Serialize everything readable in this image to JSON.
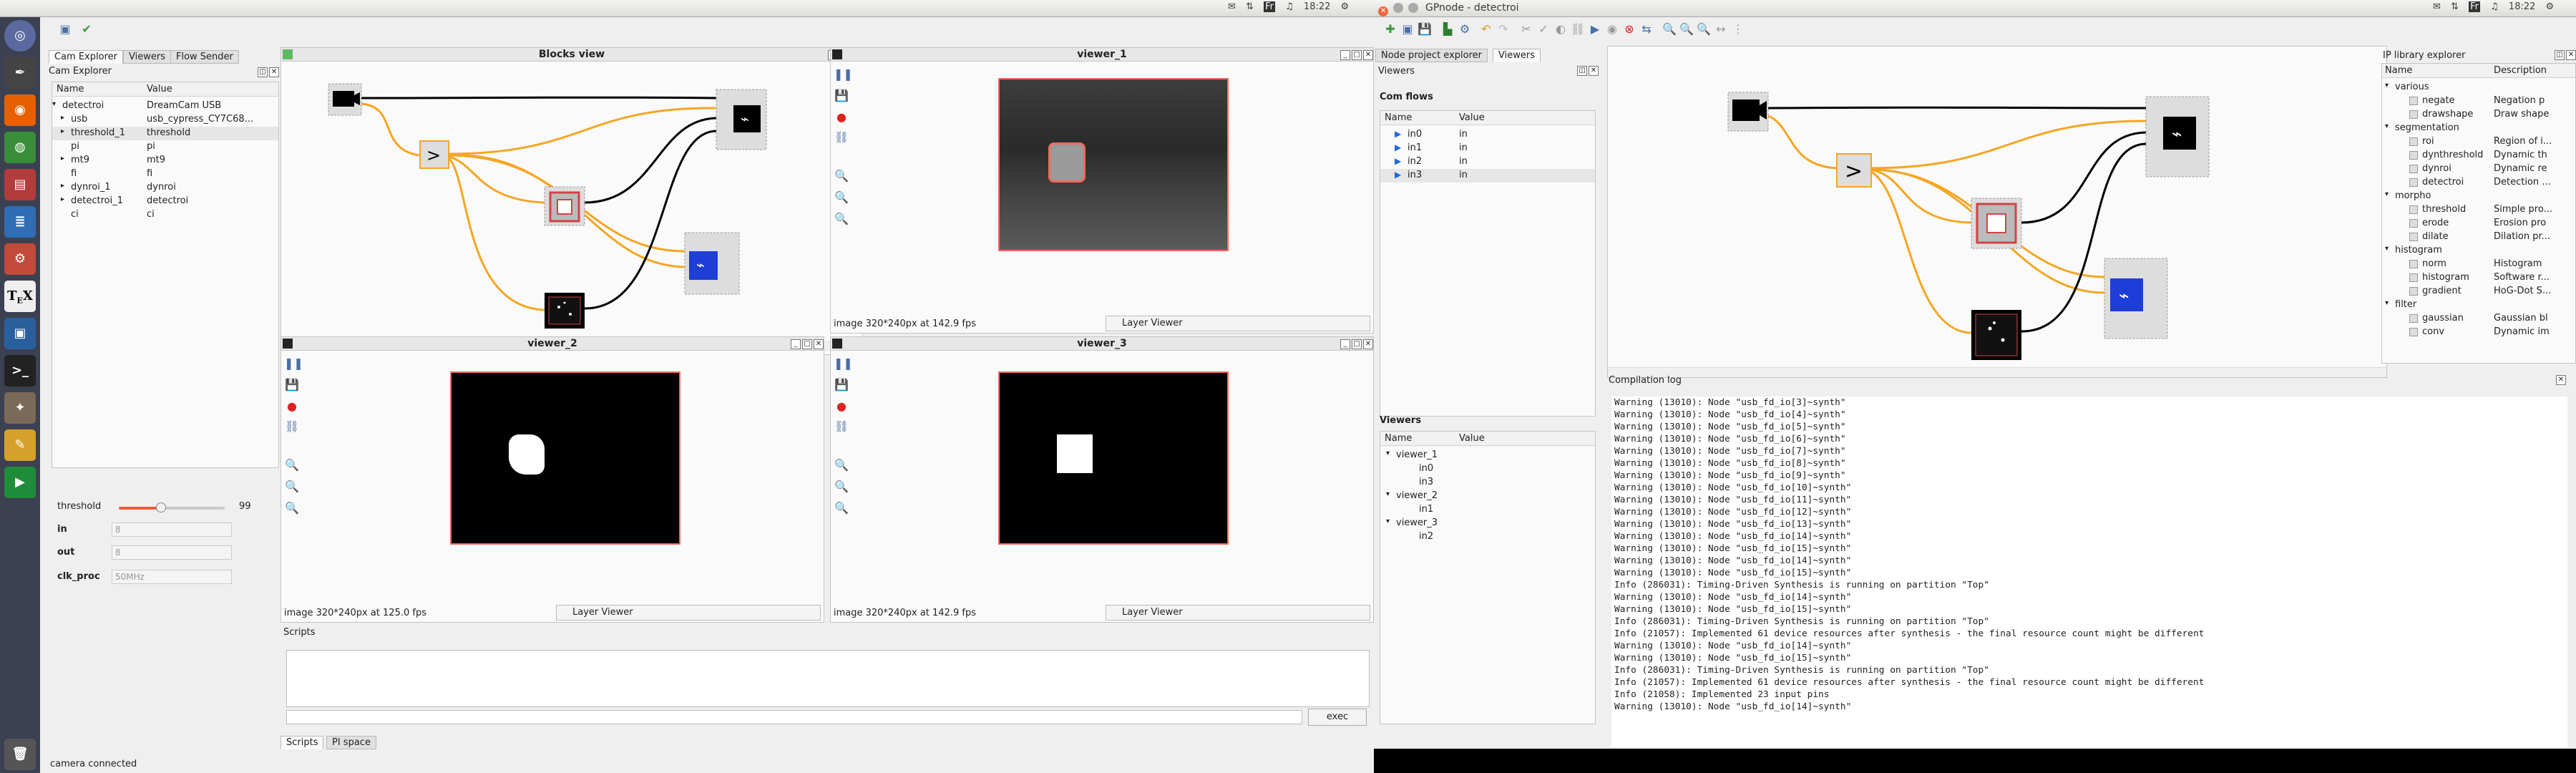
{
  "topbar": {
    "title": "GPnode - detectroi",
    "time": "18:22",
    "keyboard": "Fr",
    "tray_left": [
      "✉",
      "⇅",
      "Fr",
      "♫",
      "18:22",
      "⚙"
    ],
    "tray_right": [
      "✉",
      "⇅",
      "Fr",
      "♫",
      "18:22",
      "⚙"
    ]
  },
  "launcher": {
    "items": [
      "dash",
      "inkscape",
      "firefox",
      "chrome",
      "presentation",
      "writer",
      "settings",
      "tex",
      "display",
      "terminal",
      "gimp",
      "tools",
      "media",
      "trash"
    ]
  },
  "cam": {
    "tabs": [
      "Cam Explorer",
      "Viewers",
      "Flow Sender"
    ],
    "title": "Cam Explorer",
    "col_name": "Name",
    "col_value": "Value",
    "tree": [
      {
        "name": "detectroi",
        "value": "DreamCam USB"
      },
      {
        "name": "usb",
        "value": "usb_cypress_CY7C68..."
      },
      {
        "name": "threshold_1",
        "value": "threshold"
      },
      {
        "name": "pi",
        "value": "pi"
      },
      {
        "name": "mt9",
        "value": "mt9"
      },
      {
        "name": "fi",
        "value": "fi"
      },
      {
        "name": "dynroi_1",
        "value": "dynroi"
      },
      {
        "name": "detectroi_1",
        "value": "detectroi"
      },
      {
        "name": "ci",
        "value": "ci"
      }
    ],
    "props": {
      "threshold_label": "threshold",
      "threshold_value": 99,
      "threshold_frac": 0.4,
      "in_label": "in",
      "in_value": "8",
      "out_label": "out",
      "out_value": "8",
      "clk_label": "clk_proc",
      "clk_value": "50MHz"
    },
    "status": "camera connected"
  },
  "blocks": {
    "title": "Blocks view"
  },
  "viewers": [
    {
      "title": "viewer_1",
      "status": "image 320*240px at 142.9 fps",
      "layer": "Layer Viewer"
    },
    {
      "title": "viewer_2",
      "status": "image 320*240px at 125.0 fps",
      "layer": "Layer Viewer"
    },
    {
      "title": "viewer_3",
      "status": "image 320*240px at 142.9 fps",
      "layer": "Layer Viewer"
    }
  ],
  "scripts": {
    "title": "Scripts",
    "exec": "exec",
    "tabs": [
      "Scripts",
      "PI space"
    ]
  },
  "gp": {
    "tabs": [
      "Node project explorer",
      "Viewers"
    ],
    "viewers_title": "Viewers",
    "comflows": {
      "title": "Com flows",
      "col_name": "Name",
      "col_value": "Value",
      "rows": [
        {
          "name": "in0",
          "value": "in"
        },
        {
          "name": "in1",
          "value": "in"
        },
        {
          "name": "in2",
          "value": "in"
        },
        {
          "name": "in3",
          "value": "in"
        }
      ]
    },
    "viewers_tree": {
      "title": "Viewers",
      "col_name": "Name",
      "col_value": "Value",
      "items": [
        {
          "name": "viewer_1",
          "children": [
            "in0",
            "in3"
          ]
        },
        {
          "name": "viewer_2",
          "children": [
            "in1"
          ]
        },
        {
          "name": "viewer_3",
          "children": [
            "in2"
          ]
        }
      ]
    },
    "compilation": {
      "title": "Compilation log",
      "lines": [
        "Warning (13010): Node \"usb_fd_io[3]~synth\"",
        "Warning (13010): Node \"usb_fd_io[4]~synth\"",
        "Warning (13010): Node \"usb_fd_io[5]~synth\"",
        "Warning (13010): Node \"usb_fd_io[6]~synth\"",
        "Warning (13010): Node \"usb_fd_io[7]~synth\"",
        "Warning (13010): Node \"usb_fd_io[8]~synth\"",
        "Warning (13010): Node \"usb_fd_io[9]~synth\"",
        "Warning (13010): Node \"usb_fd_io[10]~synth\"",
        "Warning (13010): Node \"usb_fd_io[11]~synth\"",
        "Warning (13010): Node \"usb_fd_io[12]~synth\"",
        "Warning (13010): Node \"usb_fd_io[13]~synth\"",
        "Warning (13010): Node \"usb_fd_io[14]~synth\"",
        "Warning (13010): Node \"usb_fd_io[15]~synth\"",
        "Warning (13010): Node \"usb_fd_io[14]~synth\"",
        "Warning (13010): Node \"usb_fd_io[15]~synth\"",
        "Info (286031): Timing-Driven Synthesis is running on partition \"Top\"",
        "Warning (13010): Node \"usb_fd_io[14]~synth\"",
        "Warning (13010): Node \"usb_fd_io[15]~synth\"",
        "Info (286031): Timing-Driven Synthesis is running on partition \"Top\"",
        "Info (21057): Implemented 61 device resources after synthesis - the final resource count might be different",
        "Warning (13010): Node \"usb_fd_io[14]~synth\"",
        "Warning (13010): Node \"usb_fd_io[15]~synth\"",
        "Info (286031): Timing-Driven Synthesis is running on partition \"Top\"",
        "Info (21057): Implemented 61 device resources after synthesis - the final resource count might be different",
        "Info (21058): Implemented 23 input pins",
        "Warning (13010): Node \"usb_fd_io[14]~synth\""
      ]
    },
    "iplib": {
      "title": "IP library explorer",
      "col_name": "Name",
      "col_desc": "Description",
      "groups": [
        {
          "name": "various",
          "items": [
            {
              "name": "negate",
              "desc": "Negation p"
            },
            {
              "name": "drawshape",
              "desc": "Draw shape"
            }
          ]
        },
        {
          "name": "segmentation",
          "items": [
            {
              "name": "roi",
              "desc": "Region of i..."
            },
            {
              "name": "dynthreshold",
              "desc": "Dynamic th"
            },
            {
              "name": "dynroi",
              "desc": "Dynamic re"
            },
            {
              "name": "detectroi",
              "desc": "Detection ..."
            }
          ]
        },
        {
          "name": "morpho",
          "items": [
            {
              "name": "threshold",
              "desc": "Simple pro..."
            },
            {
              "name": "erode",
              "desc": "Erosion pro"
            },
            {
              "name": "dilate",
              "desc": "Dilation pr..."
            }
          ]
        },
        {
          "name": "histogram",
          "items": [
            {
              "name": "norm",
              "desc": "Histogram"
            },
            {
              "name": "histogram",
              "desc": "Software r..."
            },
            {
              "name": "gradient",
              "desc": "HoG-Dot S..."
            }
          ]
        },
        {
          "name": "filter",
          "items": [
            {
              "name": "gaussian",
              "desc": "Gaussian bl"
            },
            {
              "name": "conv",
              "desc": "Dynamic im"
            }
          ]
        }
      ]
    }
  },
  "colors": {
    "accent_flow": "#f5a623",
    "viewer_border": "#f36a5a",
    "launcher_bg": "#3b4151",
    "usb_blue": "#1d3fd8"
  }
}
